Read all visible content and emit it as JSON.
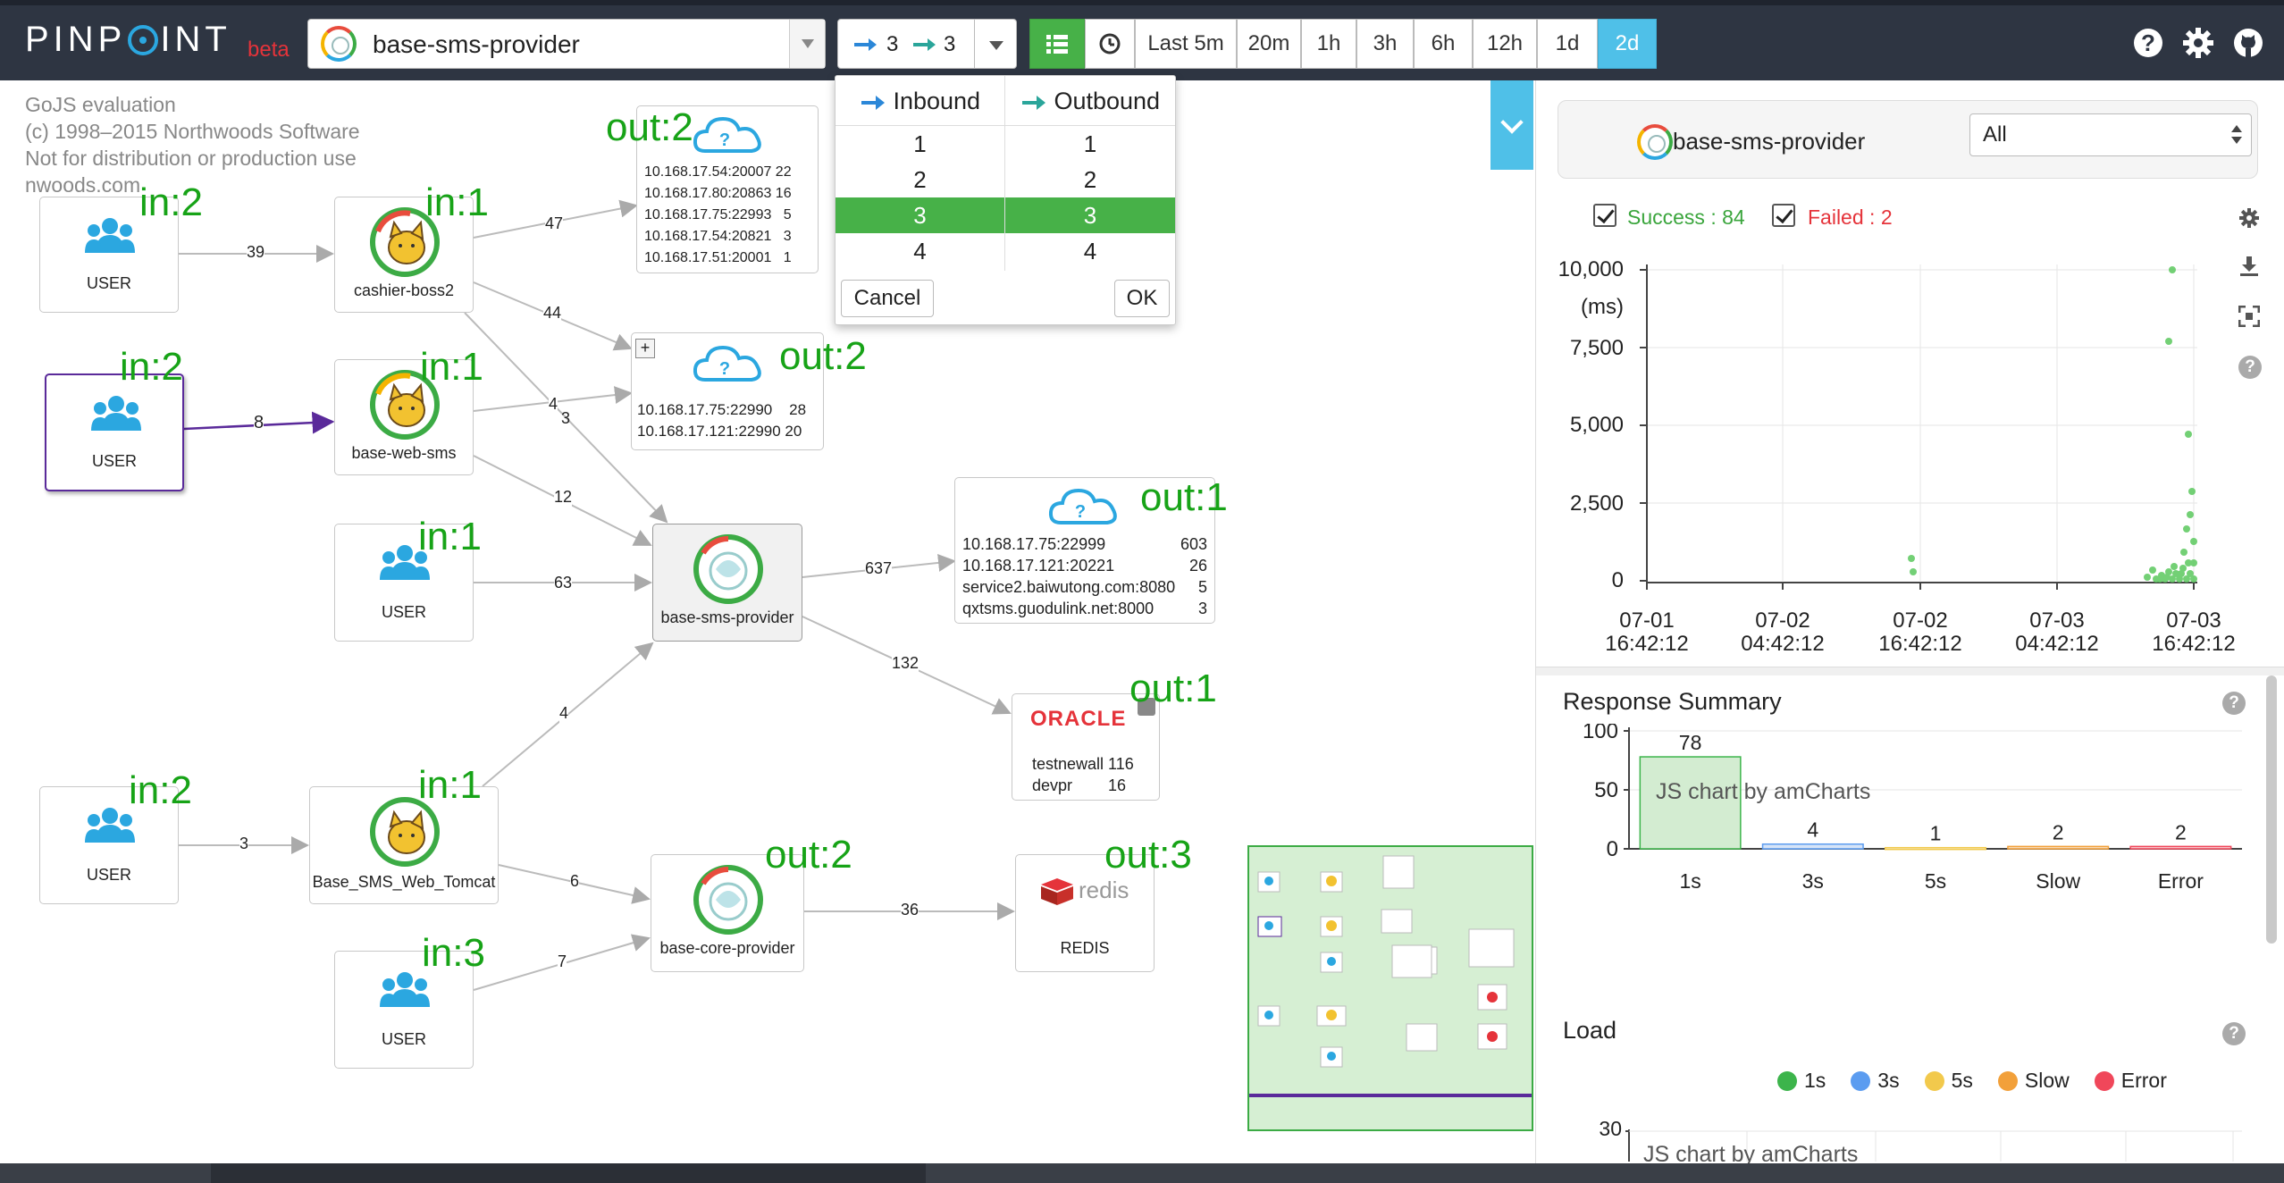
{
  "header": {
    "logo_text": "PINPOINT",
    "beta_label": "beta",
    "app_selector": {
      "name": "base-sms-provider"
    },
    "depth_button": {
      "inbound": "3",
      "outbound": "3"
    },
    "range_buttons": [
      "Last 5m",
      "20m",
      "1h",
      "3h",
      "6h",
      "12h",
      "1d",
      "2d"
    ],
    "active_range": "2d"
  },
  "watermark": [
    "GoJS evaluation",
    "(c) 1998–2015 Northwoods Software",
    "Not for distribution or production use",
    "nwoods.com"
  ],
  "depth_panel": {
    "inbound_header": "Inbound",
    "outbound_header": "Outbound",
    "inbound_options": [
      "1",
      "2",
      "3",
      "4"
    ],
    "outbound_options": [
      "1",
      "2",
      "3",
      "4"
    ],
    "selected": "3",
    "cancel_label": "Cancel",
    "ok_label": "OK"
  },
  "server_map": {
    "nodes": {
      "user1": "USER",
      "user2": "USER",
      "user3": "USER",
      "user4": "USER",
      "user5": "USER",
      "cashier": "cashier-boss2",
      "webSms": "base-web-sms",
      "provider": "base-sms-provider",
      "webTomcat": "Base_SMS_Web_Tomcat",
      "core": "base-core-provider",
      "oracle_logo": "ORACLE",
      "redis_logo": "redis",
      "redis": "REDIS"
    },
    "oracle_rows": [
      "testnewall 116",
      "devpr        16"
    ],
    "cloud1_rows": [
      "10.168.17.54:20007 22",
      "10.168.17.80:20863 16",
      "10.168.17.75:22993   5",
      "10.168.17.54:20821   3",
      "10.168.17.51:20001   1"
    ],
    "cloud2_rows": [
      "10.168.17.75:22990    28",
      "10.168.17.121:22990 20"
    ],
    "cloud3_rows": [
      "10.168.17.75:22999",
      "10.168.17.121:20221",
      "service2.baiwutong.com:8080",
      "qxtsms.guodulink.net:8000"
    ],
    "cloud3_counts": [
      "603",
      "26",
      "5",
      "3"
    ],
    "edge_labels": [
      "39",
      "47",
      "44",
      "8",
      "4",
      "3",
      "12",
      "63",
      "637",
      "132",
      "4",
      "3",
      "6",
      "7",
      "36"
    ],
    "annotations": [
      "in:2",
      "in:1",
      "in:2",
      "in:1",
      "in:1",
      "in:2",
      "in:1",
      "in:3",
      "out:2",
      "out:2",
      "out:1",
      "out:1",
      "out:2",
      "out:3"
    ]
  },
  "right_panel": {
    "app_name": "base-sms-provider",
    "filter_value": "All",
    "success_label": "Success : 84",
    "failed_label": "Failed : 2",
    "scatter": {
      "y_ticks": [
        "10,000",
        "7,500",
        "5,000",
        "2,500",
        "0"
      ],
      "y_unit": "(ms)",
      "x_ticks": [
        [
          "07-01",
          "16:42:12"
        ],
        [
          "07-02",
          "04:42:12"
        ],
        [
          "07-02",
          "16:42:12"
        ],
        [
          "07-03",
          "04:42:12"
        ],
        [
          "07-03",
          "16:42:12"
        ]
      ]
    },
    "response_summary_title": "Response Summary",
    "load_title": "Load",
    "amcharts_label": "JS chart by amCharts",
    "load_legend": [
      "1s",
      "3s",
      "5s",
      "Slow",
      "Error"
    ],
    "load_y_tick": "30",
    "colors": {
      "1s": "#3cb44b",
      "3s": "#5b9cf0",
      "5s": "#f2c94c",
      "Slow": "#f2a03a",
      "Error": "#f0475a"
    }
  },
  "chart_data": {
    "type": "bar",
    "title": "Response Summary",
    "categories": [
      "1s",
      "3s",
      "5s",
      "Slow",
      "Error"
    ],
    "values": [
      78,
      4,
      1,
      2,
      2
    ],
    "ylim": [
      0,
      100
    ],
    "y_ticks": [
      0,
      50,
      100
    ]
  }
}
